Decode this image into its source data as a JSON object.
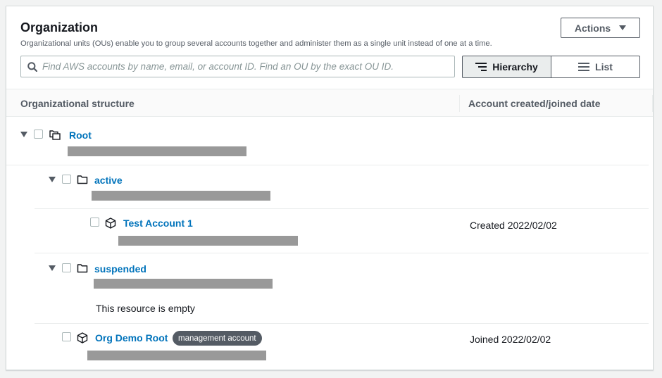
{
  "header": {
    "title": "Organization",
    "description": "Organizational units (OUs) enable you to group several accounts together and administer them as a single unit instead of one at a time.",
    "actions_label": "Actions"
  },
  "search": {
    "placeholder": "Find AWS accounts by name, email, or account ID. Find an OU by the exact OU ID."
  },
  "view_toggle": {
    "hierarchy_label": "Hierarchy",
    "list_label": "List",
    "selected": "Hierarchy"
  },
  "table": {
    "columns": [
      "Organizational structure",
      "Account created/joined date"
    ]
  },
  "tree": {
    "root": {
      "name": "Root"
    },
    "active": {
      "name": "active"
    },
    "test_account": {
      "name": "Test Account 1",
      "date": "Created 2022/02/02"
    },
    "suspended": {
      "name": "suspended",
      "empty_text": "This resource is empty"
    },
    "org_demo": {
      "name": "Org Demo Root",
      "badge": "management account",
      "date": "Joined 2022/02/02"
    }
  }
}
